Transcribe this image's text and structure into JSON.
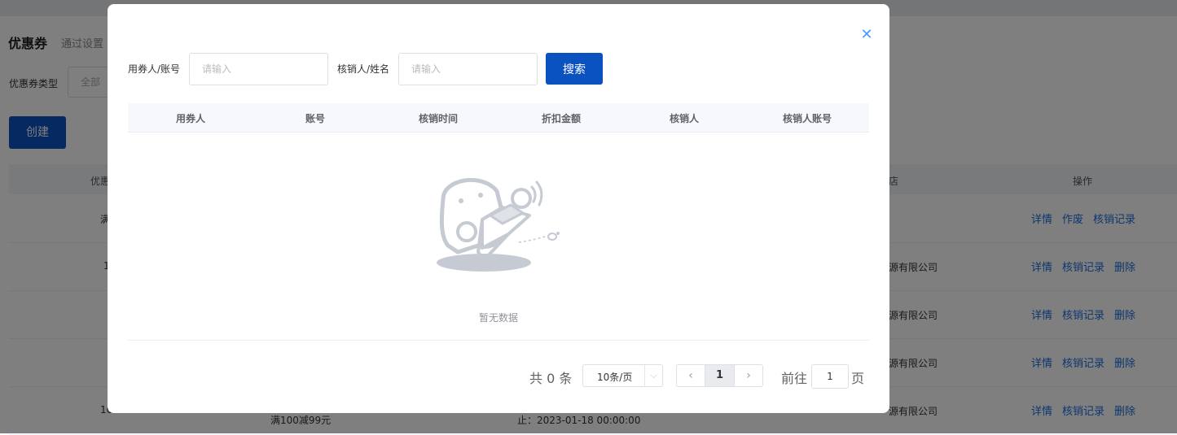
{
  "background": {
    "title": "优惠券",
    "subtitle": "通过设置",
    "filter_label": "优惠券类型",
    "filter_value": "全部",
    "create_label": "创建",
    "col_coupon": "优惠",
    "col_shop": "店",
    "col_actions": "操作",
    "rows": [
      {
        "coupon": "满",
        "shop": "",
        "actions": [
          "详情",
          "作废",
          "核销记录"
        ]
      },
      {
        "coupon": "1",
        "shop": "源有限公司",
        "actions": [
          "详情",
          "核销记录",
          "删除"
        ]
      },
      {
        "coupon": "",
        "shop": "源有限公司",
        "actions": [
          "详情",
          "核销记录",
          "删除"
        ]
      },
      {
        "coupon": "",
        "shop": "源有限公司",
        "actions": [
          "详情",
          "核销记录",
          "删除"
        ]
      },
      {
        "coupon": "10",
        "shop": "源有限公司",
        "actions": [
          "详情",
          "核销记录",
          "删除"
        ],
        "coupon_sub": "满100减99元",
        "time": "止：2023-01-18 00:00:00"
      }
    ]
  },
  "dialog": {
    "close_icon": "close-icon",
    "form": {
      "user_label": "用券人/账号",
      "user_placeholder": "请输入",
      "verifier_label": "核销人/姓名",
      "verifier_placeholder": "请输入",
      "search_label": "搜索"
    },
    "table": {
      "columns": [
        "用券人",
        "账号",
        "核销时间",
        "折扣金额",
        "核销人",
        "核销人账号"
      ],
      "empty_text": "暂无数据"
    },
    "pagination": {
      "total": "共 0 条",
      "page_size": "10条/页",
      "current_page": "1",
      "goto_label": "前往",
      "goto_value": "1",
      "page_suffix": "页"
    }
  }
}
